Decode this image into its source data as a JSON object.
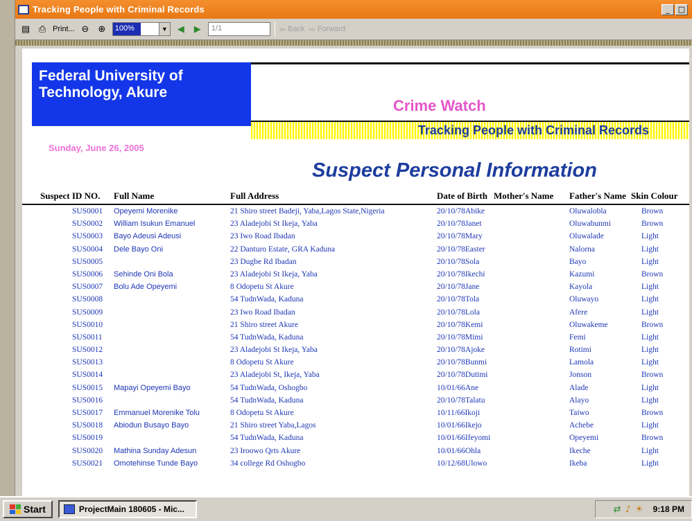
{
  "window": {
    "title": "Tracking People with Criminal Records",
    "minimize_glyph": "_",
    "maximize_glyph": "□"
  },
  "toolbar": {
    "print_label": "Print...",
    "zoom_value": "100%",
    "page_value": "1/1",
    "back_label": "Back",
    "forward_label": "Forward"
  },
  "report": {
    "institution_line1": "Federal University of",
    "institution_line2": "Technology, Akure",
    "brand": "Crime Watch",
    "subtitle": "Tracking People with Criminal Records",
    "date": "Sunday, June 26, 2005",
    "section_title": "Suspect Personal Information",
    "columns": {
      "id": "Suspect ID NO.",
      "name": "Full Name",
      "address": "Full Address",
      "dob": "Date of Birth",
      "mother": "Mother's Name",
      "father": "Father's Name",
      "skin": "Skin Colour"
    },
    "rows": [
      {
        "id": "SUS0001",
        "name": "Opeyemi Morenike",
        "address": "21 Shiro street Badeji, Yaba,Lagos State,Nigeria",
        "dob": "20/10/78Abike",
        "father": "Oluwalobla",
        "skin": "Brown"
      },
      {
        "id": "SUS0002",
        "name": "William Isukun Emanuel",
        "address": "23 Aladejobi St Ikeja, Yaba",
        "dob": "20/10/78Janet",
        "father": "Oluwabunmi",
        "skin": "Brown"
      },
      {
        "id": "SUS0003",
        "name": "Bayo Adeusi Adeusi",
        "address": "23 Iwo Road Ibadan",
        "dob": "20/10/78Mary",
        "father": "Oluwalade",
        "skin": "Light"
      },
      {
        "id": "SUS0004",
        "name": "Dele Bayo Oni",
        "address": "22 Danturo Estate, GRA Kaduna",
        "dob": "20/10/78Easter",
        "father": "Nalorna",
        "skin": "Light"
      },
      {
        "id": "SUS0005",
        "name": "",
        "address": "23 Dugbe Rd Ibadan",
        "dob": "20/10/78Sola",
        "father": "Bayo",
        "skin": "Light"
      },
      {
        "id": "SUS0006",
        "name": "Sehinde Oni Bola",
        "address": "23 Aladejobi St Ikeja, Yaba",
        "dob": "20/10/78Ikechi",
        "father": "Kazumi",
        "skin": "Brown"
      },
      {
        "id": "SUS0007",
        "name": "Bolu Ade Opeyemi",
        "address": "8 Odopetu St Akure",
        "dob": "20/10/78Jane",
        "father": "Kayola",
        "skin": "Light"
      },
      {
        "id": "SUS0008",
        "name": "",
        "address": "54 TudnWada, Kaduna",
        "dob": "20/10/78Tola",
        "father": "Oluwayo",
        "skin": "Light"
      },
      {
        "id": "SUS0009",
        "name": "",
        "address": "23 Iwo Road Ibadan",
        "dob": "20/10/78Lola",
        "father": "Afere",
        "skin": "Light"
      },
      {
        "id": "SUS0010",
        "name": "",
        "address": "21 Shiro street Akure",
        "dob": "20/10/78Kemi",
        "father": "Oluwakeme",
        "skin": "Brown"
      },
      {
        "id": "SUS0011",
        "name": "",
        "address": "54 TudnWada, Kaduna",
        "dob": "20/10/78Mimi",
        "father": "Femi",
        "skin": "Light"
      },
      {
        "id": "SUS0012",
        "name": "",
        "address": "23 Aladejobi St Ikeja, Yaba",
        "dob": "20/10/78Ajoke",
        "father": "Rotimi",
        "skin": "Light"
      },
      {
        "id": "SUS0013",
        "name": "",
        "address": "8 Odopetu St Akure",
        "dob": "20/10/78Bunmi",
        "father": "Lamola",
        "skin": "Light"
      },
      {
        "id": "SUS0014",
        "name": "",
        "address": "23 Aladejobi St, Ikeja, Yaba",
        "dob": "20/10/78Dutimi",
        "father": "Jonson",
        "skin": "Brown"
      },
      {
        "id": "SUS0015",
        "name": "Mapayi Opeyemi Bayo",
        "address": "54 TudnWada, Oshogbo",
        "dob": "10/01/66Ane",
        "father": "Alade",
        "skin": "Light"
      },
      {
        "id": "SUS0016",
        "name": "",
        "address": "54 TudnWada, Kaduna",
        "dob": "20/10/78Talatu",
        "father": "Alayo",
        "skin": "Light"
      },
      {
        "id": "SUS0017",
        "name": "Emmanuel Morenike Tolu",
        "address": "8 Odopetu St Akure",
        "dob": "10/11/66Ikoji",
        "father": "Taiwo",
        "skin": "Brown"
      },
      {
        "id": "SUS0018",
        "name": "Abiodun Busayo Bayo",
        "address": "21 Shiro street Yaba,Lagos",
        "dob": "10/01/66Ikejo",
        "father": "Achebe",
        "skin": "Light"
      },
      {
        "id": "SUS0019",
        "name": "",
        "address": "54 TudnWada, Kaduna",
        "dob": "10/01/66Ifeyomi",
        "father": "Opeyemi",
        "skin": "Brown"
      },
      {
        "id": "SUS0020",
        "name": "Mathina Sunday Adesun",
        "address": "23 Iroowo Qrts Akure",
        "dob": "10/01/66Ohla",
        "father": "Ikeche",
        "skin": "Light"
      },
      {
        "id": "SUS0021",
        "name": "Omotehinse Tunde Bayo",
        "address": "34 college Rd Oshogbo",
        "dob": "10/12/68Ulowo",
        "father": "Ikeba",
        "skin": "Light"
      }
    ]
  },
  "taskbar": {
    "start_label": "Start",
    "task_label": "ProjectMain 180605 - Mic...",
    "clock": "9:18 PM"
  },
  "colors": {
    "titlebar": "#e87814",
    "institution_box": "#1337e8",
    "brand_pink": "#e556c9",
    "row_text": "#1d36b5",
    "band_yellow": "#fff600"
  }
}
